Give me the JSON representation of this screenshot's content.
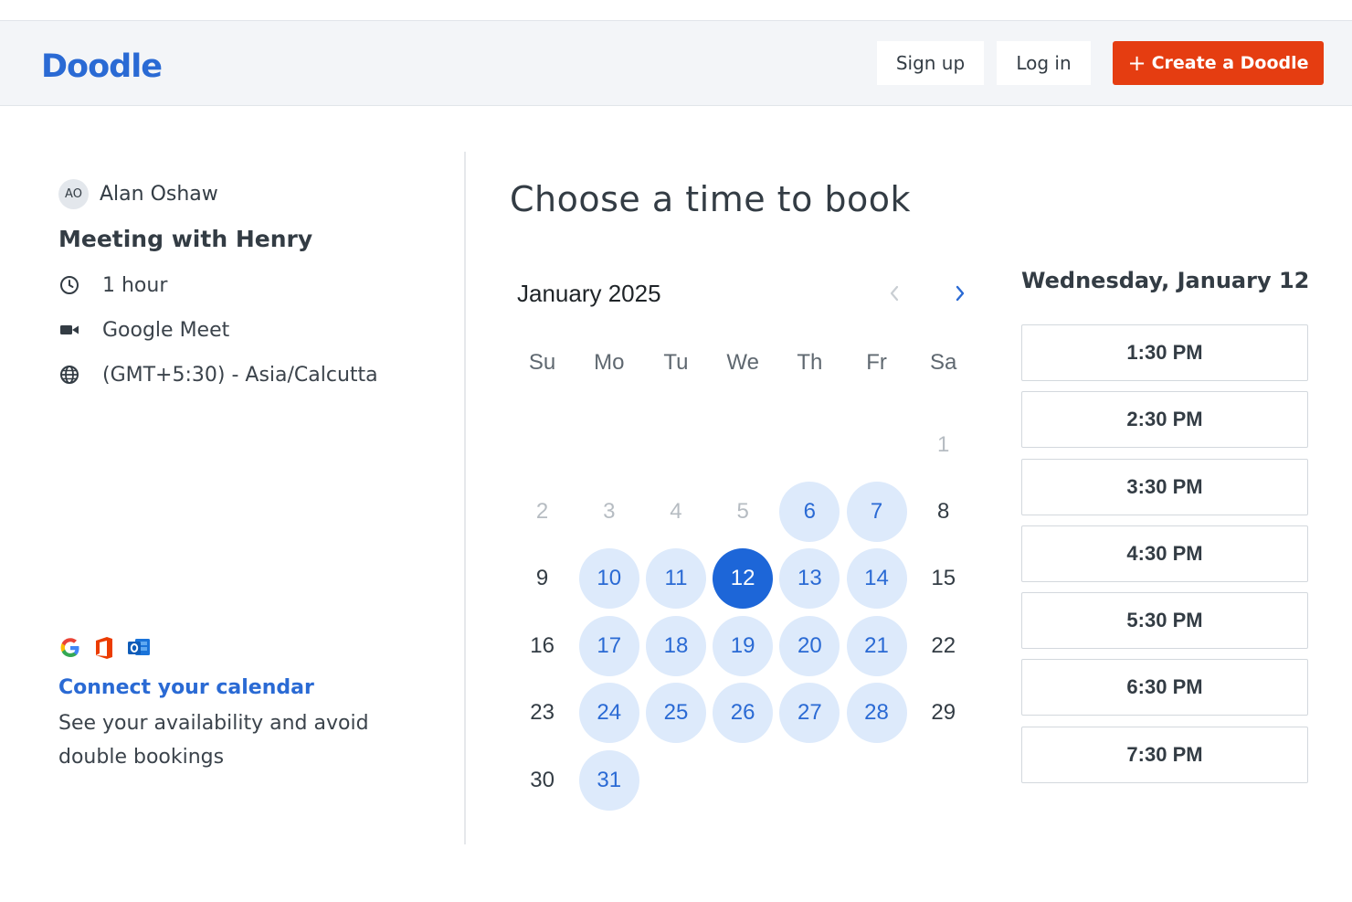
{
  "header": {
    "logo": "Doodle",
    "signup_label": "Sign up",
    "login_label": "Log in",
    "create_label": "Create a Doodle",
    "create_icon": "+",
    "accent_color": "#e53d11",
    "brand_color": "#2a6ad4"
  },
  "event": {
    "host_initials": "AO",
    "host_name": "Alan Oshaw",
    "title": "Meeting with Henry",
    "details": [
      {
        "icon": "clock-icon",
        "text": "1 hour"
      },
      {
        "icon": "video-camera-icon",
        "text": "Google Meet"
      },
      {
        "icon": "globe-icon",
        "text": "(GMT+5:30) - Asia/Calcutta"
      }
    ]
  },
  "calendar_connect": {
    "providers": [
      "google-icon",
      "office-icon",
      "outlook-icon"
    ],
    "link_label": "Connect your calendar",
    "description": "See your availability and avoid double bookings"
  },
  "booking": {
    "title": "Choose a time to book",
    "month_label": "January 2025",
    "weekdays": [
      "Su",
      "Mo",
      "Tu",
      "We",
      "Th",
      "Fr",
      "Sa"
    ],
    "leading_blanks": 6,
    "days": [
      {
        "n": "1",
        "state": "muted"
      },
      {
        "n": "2",
        "state": "muted"
      },
      {
        "n": "3",
        "state": "muted"
      },
      {
        "n": "4",
        "state": "muted"
      },
      {
        "n": "5",
        "state": "muted"
      },
      {
        "n": "6",
        "state": "avail"
      },
      {
        "n": "7",
        "state": "avail"
      },
      {
        "n": "8",
        "state": "plain"
      },
      {
        "n": "9",
        "state": "plain"
      },
      {
        "n": "10",
        "state": "avail"
      },
      {
        "n": "11",
        "state": "avail"
      },
      {
        "n": "12",
        "state": "selected"
      },
      {
        "n": "13",
        "state": "avail"
      },
      {
        "n": "14",
        "state": "avail"
      },
      {
        "n": "15",
        "state": "plain"
      },
      {
        "n": "16",
        "state": "plain"
      },
      {
        "n": "17",
        "state": "avail"
      },
      {
        "n": "18",
        "state": "avail"
      },
      {
        "n": "19",
        "state": "avail"
      },
      {
        "n": "20",
        "state": "avail"
      },
      {
        "n": "21",
        "state": "avail"
      },
      {
        "n": "22",
        "state": "plain"
      },
      {
        "n": "23",
        "state": "plain"
      },
      {
        "n": "24",
        "state": "avail"
      },
      {
        "n": "25",
        "state": "avail"
      },
      {
        "n": "26",
        "state": "avail"
      },
      {
        "n": "27",
        "state": "avail"
      },
      {
        "n": "28",
        "state": "avail"
      },
      {
        "n": "29",
        "state": "plain"
      },
      {
        "n": "30",
        "state": "plain"
      },
      {
        "n": "31",
        "state": "avail"
      }
    ],
    "selected_date_label": "Wednesday, January 12",
    "time_slots": [
      "1:30 PM",
      "2:30 PM",
      "3:30 PM",
      "4:30 PM",
      "5:30 PM",
      "6:30 PM",
      "7:30 PM"
    ]
  }
}
